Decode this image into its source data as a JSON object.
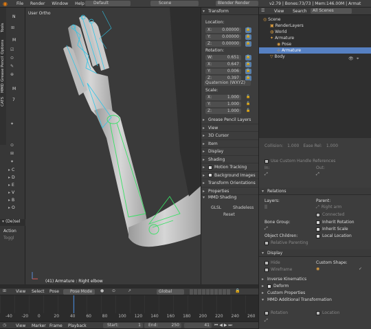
{
  "topbar": {
    "menus": [
      "File",
      "Render",
      "Window",
      "Help"
    ],
    "layout": "Default",
    "scene": "Scene",
    "engine": "Blender Render",
    "stats": "v2.79 | Bones:73/73 | Mem:146.00M | Armat"
  },
  "left_toolbar": {
    "vertical_tabs": [
      "Tools",
      "Options",
      "Grease Pencil",
      "MMD",
      "CATS"
    ],
    "letters_top": [
      "N",
      "M",
      "M",
      "7"
    ],
    "letters_list": [
      "C",
      "D",
      "E",
      "V",
      "B",
      "O"
    ],
    "desel": "(De)sel",
    "action": "Action",
    "toggle": "Toggl"
  },
  "viewport": {
    "view_label": "User Ortho",
    "object_label": "(41) Armature : Right elbow"
  },
  "npanel": {
    "transform_header": "Transform",
    "location_label": "Location:",
    "location": [
      {
        "axis": "X:",
        "value": "0.00000"
      },
      {
        "axis": "Y:",
        "value": "0.00000"
      },
      {
        "axis": "Z:",
        "value": "0.00000"
      }
    ],
    "rotation_label": "Rotation:",
    "rotation": [
      {
        "axis": "W:",
        "value": "0.651"
      },
      {
        "axis": "X:",
        "value": "0.647"
      },
      {
        "axis": "Y:",
        "value": "0.006"
      },
      {
        "axis": "Z:",
        "value": "0.397"
      }
    ],
    "rotation_mode": "Quaternion (WXYZ)",
    "scale_label": "Scale:",
    "scale": [
      {
        "axis": "X:",
        "value": "1.000"
      },
      {
        "axis": "Y:",
        "value": "1.000"
      },
      {
        "axis": "Z:",
        "value": "1.000"
      }
    ],
    "sections": [
      {
        "label": "Grease Pencil Layers",
        "check": false
      },
      {
        "label": "View",
        "check": false
      },
      {
        "label": "3D Cursor",
        "check": false
      },
      {
        "label": "Item",
        "check": false
      },
      {
        "label": "Display",
        "check": false
      },
      {
        "label": "Shading",
        "check": false
      },
      {
        "label": "Motion Tracking",
        "check": true
      },
      {
        "label": "Background Images",
        "check": true
      },
      {
        "label": "Transform Orientations",
        "check": false
      },
      {
        "label": "Properties",
        "check": false
      }
    ],
    "mmd_header": "MMD Shading",
    "mmd_buttons": [
      "GLSL",
      "Shadeless"
    ],
    "reset": "Reset"
  },
  "outliner": {
    "view": "View",
    "search": "Search",
    "filter": "All Scenes",
    "items": [
      {
        "label": "Scene",
        "indent": 0,
        "sel": false
      },
      {
        "label": "RenderLayers",
        "indent": 1,
        "sel": false
      },
      {
        "label": "World",
        "indent": 1,
        "sel": false
      },
      {
        "label": "Armature",
        "indent": 1,
        "sel": false
      },
      {
        "label": "Pose",
        "indent": 2,
        "sel": false
      },
      {
        "label": "Armature",
        "indent": 2,
        "sel": true
      },
      {
        "label": "Body",
        "indent": 1,
        "sel": false
      }
    ]
  },
  "properties": {
    "top_row": [
      "Collision:",
      "1.000",
      "Ease Rel:",
      "1.000"
    ],
    "custom_handle": "Use Custom Handle References",
    "in_label": "In:",
    "out_label": "Out:",
    "relations_header": "Relations",
    "layers_label": "Layers:",
    "parent_label": "Parent:",
    "parent_value": "Right arm",
    "connected": "Connected",
    "bone_group_label": "Bone Group:",
    "inherit_rotation": "Inherit Rotation",
    "inherit_scale": "Inherit Scale",
    "object_children": "Object Children:",
    "local_location": "Local Location",
    "relative_parenting": "Relative Parenting",
    "display_header": "Display",
    "hide": "Hide",
    "wireframe": "Wireframe",
    "custom_shape": "Custom Shape:",
    "ik_header": "Inverse Kinematics",
    "deform": "Deform",
    "custom_props": "Custom Properties",
    "mmd_header": "MMD Additional Transformation",
    "rotation": "Rotation",
    "location": "Location"
  },
  "view3d_header": {
    "menus": [
      "View",
      "Select",
      "Pose"
    ],
    "mode": "Pose Mode",
    "orientation": "Global"
  },
  "timeline": {
    "ticks": [
      "-40",
      "-20",
      "0",
      "20",
      "40",
      "60",
      "80",
      "100",
      "120",
      "140",
      "160",
      "180",
      "200",
      "220",
      "240",
      "260"
    ],
    "current_frame": 41,
    "menus": [
      "View",
      "Marker",
      "Frame",
      "Playback"
    ],
    "start_label": "Start:",
    "start": "1",
    "end_label": "End:",
    "end": "250",
    "frame": "41"
  }
}
